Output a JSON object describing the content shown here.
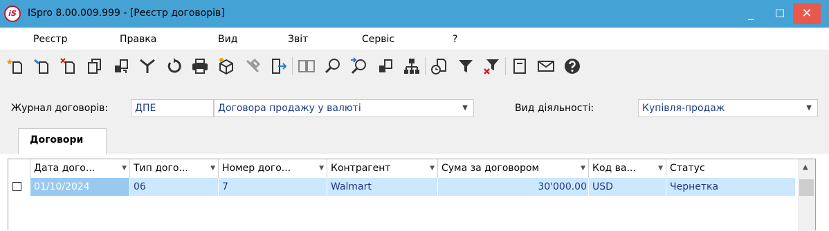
{
  "window": {
    "logo_text": "iS",
    "title": "ISpro 8.00.009.999 - [Реєстр договорів]",
    "min_glyph": "_",
    "max_glyph": "☐",
    "close_glyph": "✕"
  },
  "menu": [
    "Реєстр",
    "Правка",
    "Вид",
    "Звіт",
    "Сервіс",
    "?"
  ],
  "toolbar": {
    "icons": [
      "new-document-icon",
      "edit-document-icon",
      "delete-document-icon",
      "copy-document-icon",
      "move-icon",
      "merge-icon",
      "refresh-icon",
      "print-icon",
      "package-icon",
      "tools-icon",
      "exit-icon",
      "book-icon",
      "search-icon",
      "search-next-icon",
      "transfer-icon",
      "hierarchy-icon",
      "history-document-icon",
      "filter-icon",
      "clear-filter-icon",
      "notepad-icon",
      "mail-icon",
      "help-icon"
    ]
  },
  "filters": {
    "journal_label": "Журнал договорів:",
    "journal_code": "ДПЕ",
    "journal_name": "Договора продажу у валюті",
    "activity_label": "Вид діяльності:",
    "activity_value": "Купівля-продаж"
  },
  "tabs": {
    "contracts": "Договори"
  },
  "table": {
    "columns": [
      "Дата дого...",
      "Тип дого...",
      "Номер дого...",
      "Контрагент",
      "Сума за договором",
      "Код ва...",
      "Статус"
    ],
    "rows": [
      {
        "checked": false,
        "date": "01/10/2024",
        "type": "06",
        "number": "7",
        "counterparty": "Walmart",
        "amount": "30'000.00",
        "currency": "USD",
        "status": "Чернетка"
      }
    ]
  },
  "colors": {
    "titlebar": "#45a2d4",
    "close_button": "#e8584d",
    "selected_row": "#cce8ff",
    "selected_cell": "#99c9ef",
    "link_text": "#1a3b8a"
  }
}
